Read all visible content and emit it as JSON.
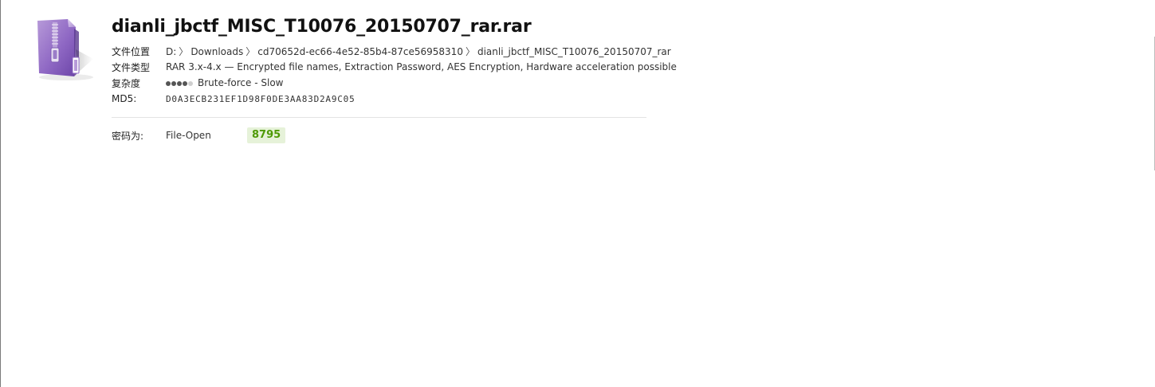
{
  "file": {
    "name": "dianli_jbctf_MISC_T10076_20150707_rar.rar",
    "icon": "zip-archive-icon",
    "location_label": "文件位置",
    "location_path": [
      "D:",
      "Downloads",
      "cd70652d-ec66-4e52-85b4-87ce56958310",
      "dianli_jbctf_MISC_T10076_20150707_rar"
    ],
    "path_separator": "〉",
    "type_label": "文件类型",
    "type_value": "RAR 3.x-4.x — Encrypted file names, Extraction Password, AES Encryption, Hardware acceleration possible",
    "complexity_label": "复杂度",
    "complexity_level": 4,
    "complexity_max": 5,
    "complexity_text": "Brute-force - Slow",
    "md5_label": "MD5:",
    "md5_value": "D0A3ECB231EF1D98F0DE3AA83D2A9C05"
  },
  "result": {
    "label": "密码为:",
    "method": "File-Open",
    "password": "8795",
    "password_badge_color": "#e6f2d9",
    "password_text_color": "#4e9a06"
  }
}
